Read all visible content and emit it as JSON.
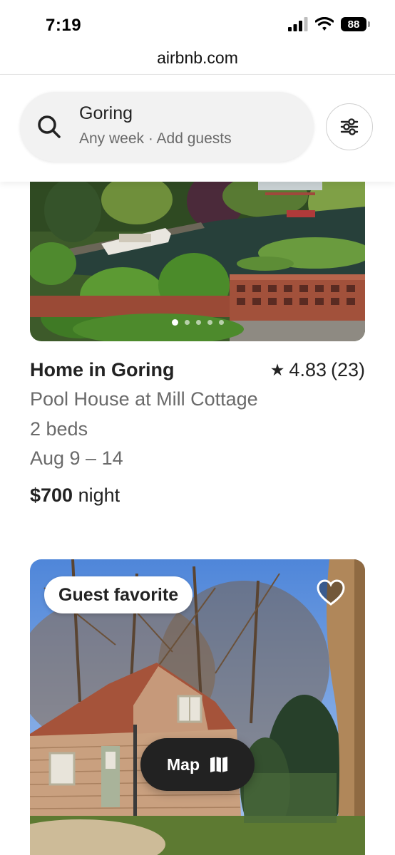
{
  "status_bar": {
    "time": "7:19",
    "battery": "88"
  },
  "browser": {
    "url": "airbnb.com"
  },
  "search": {
    "location": "Goring",
    "subtitle": "Any week · Add guests"
  },
  "listings": [
    {
      "title": "Home in Goring",
      "rating": "4.83",
      "reviews": "(23)",
      "subtitle": "Pool House at Mill Cottage",
      "beds": "2 beds",
      "dates": "Aug 9 – 14",
      "price": "$700",
      "price_unit": "night",
      "photo_count": 5,
      "active_photo": 1
    },
    {
      "badge": "Guest favorite"
    }
  ],
  "map_button": {
    "label": "Map"
  },
  "colors": {
    "text": "#222222",
    "muted": "#6a6a6a",
    "pill": "#f2f2f2",
    "map_button": "#222222"
  }
}
